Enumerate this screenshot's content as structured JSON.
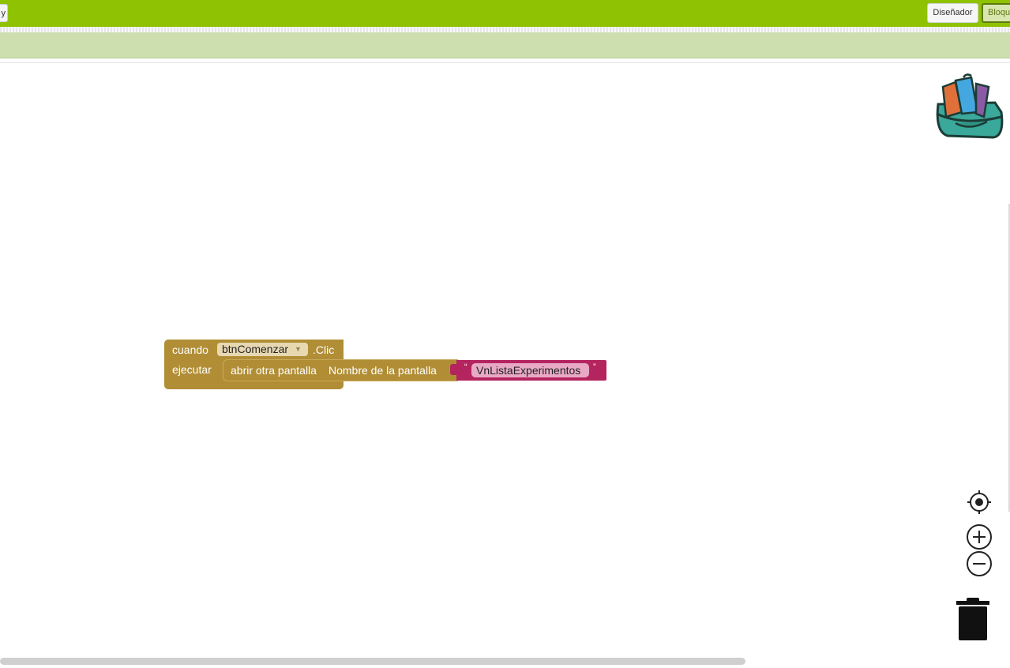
{
  "header": {
    "left_button_label": "y",
    "designer_label": "Diseñador",
    "blocks_label": "Bloques"
  },
  "colors": {
    "header": "#8fc202",
    "toolbar": "#cddfae",
    "control_block": "#b18e35",
    "text_block": "#b4245f"
  },
  "event_block": {
    "when_label": "cuando",
    "component": "btnComenzar",
    "event": ".Clic",
    "do_label": "ejecutar"
  },
  "call_block": {
    "label": "abrir otra pantalla",
    "param_label": "Nombre de la pantalla"
  },
  "text_block": {
    "open_quote": "“",
    "value": "VnListaExperimentos",
    "close_quote": "”"
  },
  "icons": {
    "backpack": "backpack-icon",
    "recenter": "recenter-icon",
    "zoom_in": "zoom-in-icon",
    "zoom_out": "zoom-out-icon",
    "trash": "trash-icon"
  }
}
